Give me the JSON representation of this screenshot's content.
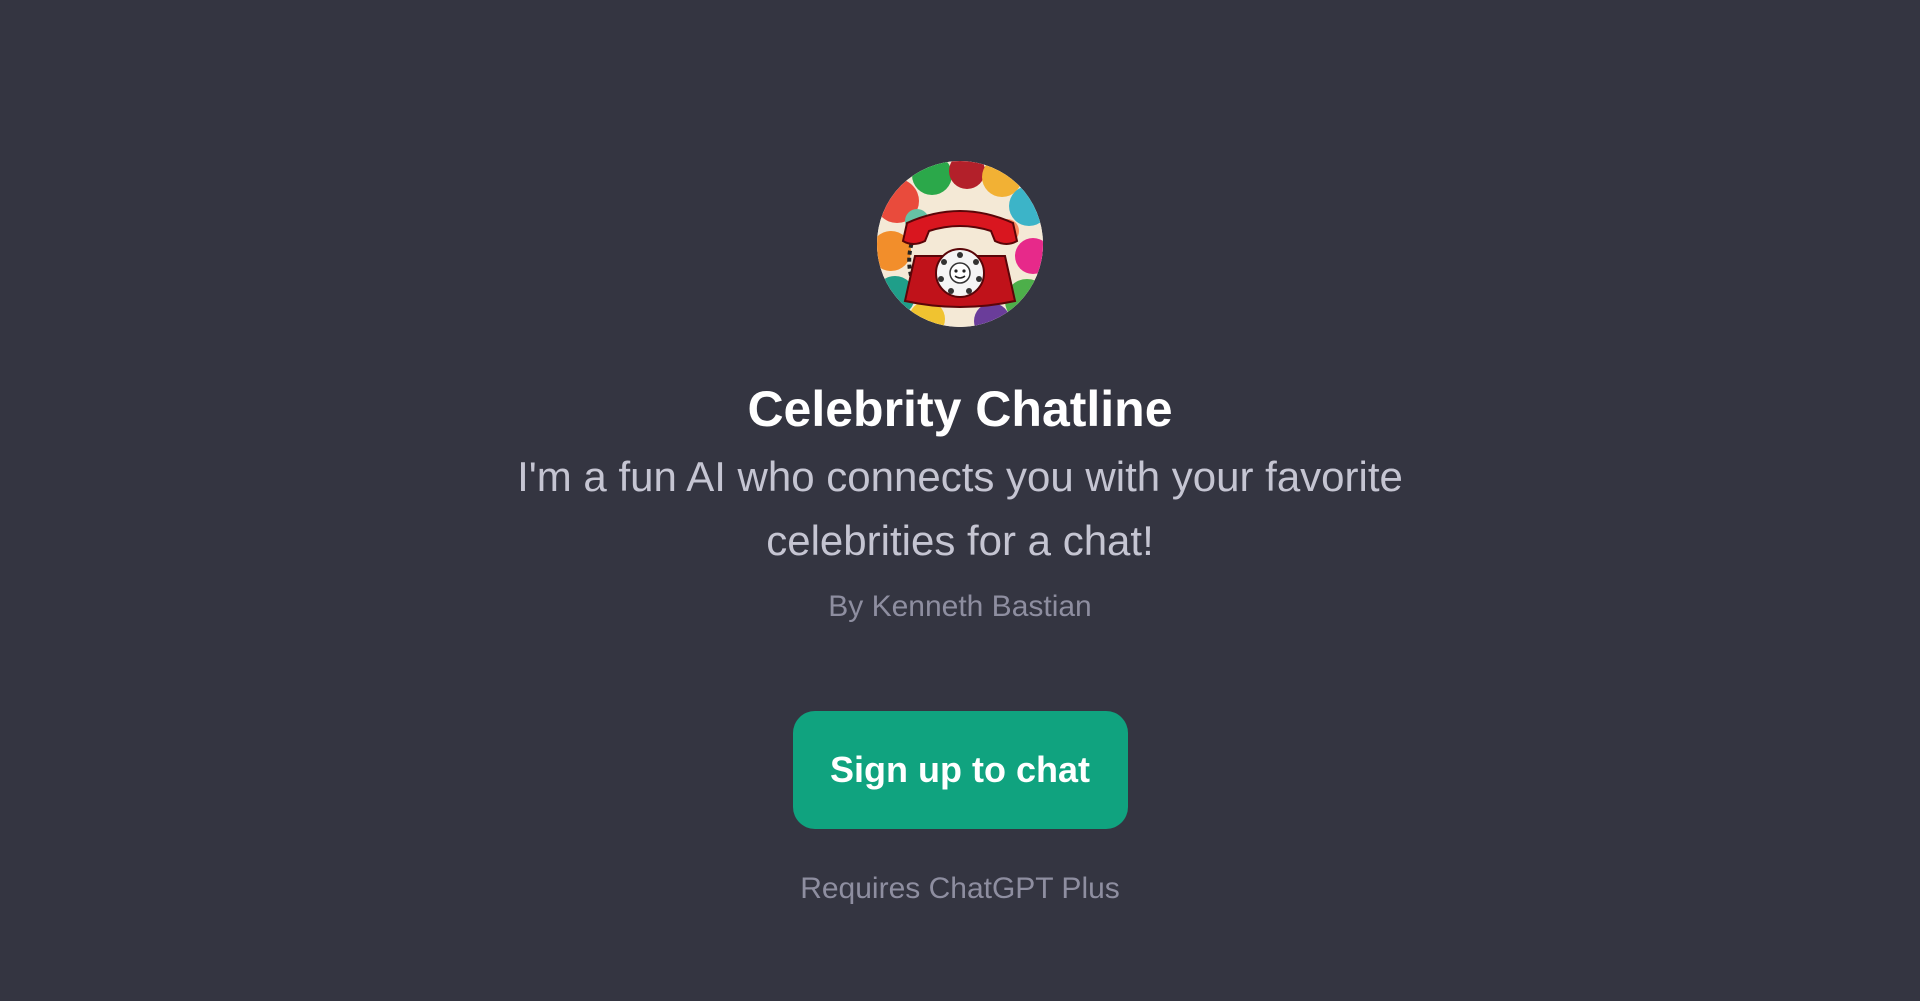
{
  "gpt": {
    "avatar_icon": "red-rotary-telephone-icon",
    "title": "Celebrity Chatline",
    "description": "I'm a fun AI who connects you with your favorite celebrities for a chat!",
    "author": "By Kenneth Bastian"
  },
  "cta": {
    "signup_label": "Sign up to chat",
    "requirement": "Requires ChatGPT Plus"
  },
  "colors": {
    "background": "#343541",
    "accent": "#10a37f",
    "title": "#ffffff",
    "description": "#c5c5d2",
    "muted": "#8e8ea0"
  }
}
